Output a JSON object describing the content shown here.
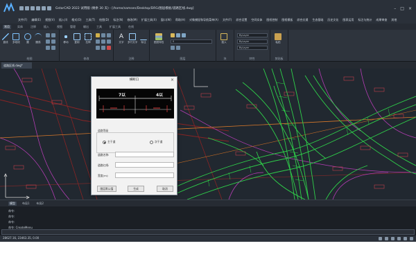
{
  "app": {
    "title": "GstarCAD 2022 试用版 (剩余 30 天) - [/home/samsen/Desktop/DRG/图层模板/道路区线.dwg]",
    "window_controls": [
      "–",
      "□",
      "×"
    ]
  },
  "menubar": {
    "items": [
      "文件(F)",
      "编辑(E)",
      "视图(V)",
      "插入(I)",
      "格式(O)",
      "工具(T)",
      "绘图(D)",
      "标注(N)",
      "修改(M)",
      "扩展工具(X)",
      "窗口(W)",
      "帮助(H)",
      "对象捕捉和导航菜单(A)",
      "文件(F)",
      "综合设置",
      "空间实体",
      "图纸控制",
      "图框模板",
      "综合交通",
      "生态基础",
      "历史文化",
      "图表运用",
      "标注与统计",
      "成果审查",
      "其他"
    ]
  },
  "ribbon_tabs": {
    "items": [
      "常用",
      "实体",
      "注释",
      "插入",
      "视图",
      "管理",
      "输出",
      "工具",
      "扩展工具",
      "在线"
    ],
    "active_index": 0
  },
  "ribbon": {
    "groups": [
      {
        "name": "绘图",
        "tools": [
          "直线",
          "多段线",
          "圆",
          "圆弧"
        ]
      },
      {
        "name": "修改",
        "tools": [
          "移动",
          "复制",
          "拉伸"
        ]
      },
      {
        "name": "注释",
        "tools": [
          "文字",
          "多行文字",
          "标注"
        ]
      },
      {
        "name": "图层",
        "tools": [
          "图层特性"
        ]
      },
      {
        "name": "块",
        "tools": [
          "插入"
        ]
      },
      {
        "name": "特性",
        "tools": [
          "特性匹配"
        ]
      },
      {
        "name": "剪贴板",
        "tools": [
          "粘贴"
        ]
      }
    ],
    "layer_dropdown": "0",
    "color_dropdown": "ByLayer",
    "linetype_dropdown": "ByLayer",
    "lineweight_dropdown": "ByLayer"
  },
  "doc_tab": {
    "label": "道路区线.dwg*"
  },
  "canvas": {
    "label_text": "P-ROAD-X",
    "colors": {
      "background": "#212830",
      "road_green": "#2fd14a",
      "boundary_magenta": "#b43db4",
      "road_red": "#b02a2a",
      "axis_orange": "#d9792a",
      "label_red": "#c2404a"
    }
  },
  "dialog": {
    "title": "横断口",
    "close": "×",
    "preview_left_text": "7以",
    "preview_right_text": "4以",
    "group_label": "道路等级",
    "radio_options": [
      "主干道",
      "次干道"
    ],
    "selected_radio": 0,
    "fields": [
      {
        "label": "道路名称:",
        "value": ""
      },
      {
        "label": "道路红线:",
        "value": ""
      },
      {
        "label": "宽度(m):",
        "value": ""
      }
    ],
    "buttons": [
      "图层默认值",
      "生成",
      "取消"
    ]
  },
  "command": {
    "tabs": [
      "模型",
      "布局1",
      "布局2"
    ],
    "active_tab": 0,
    "lines": [
      "命令:",
      "命令:",
      "命令:",
      "命令: CreateMenu"
    ],
    "input": ""
  },
  "status": {
    "coords": "28627.16, 23463.35, 0.00"
  }
}
